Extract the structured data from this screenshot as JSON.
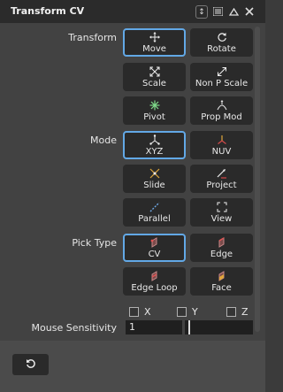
{
  "window": {
    "title": "Transform CV"
  },
  "titlebar_icons": [
    "dock-icon",
    "menu-icon",
    "collapse-icon",
    "close-icon"
  ],
  "sections": {
    "transform": {
      "label": "Transform",
      "buttons": [
        {
          "label": "Move",
          "icon": "move-icon",
          "active": true
        },
        {
          "label": "Rotate",
          "icon": "rotate-icon",
          "active": false
        },
        {
          "label": "Scale",
          "icon": "scale-icon",
          "active": false
        },
        {
          "label": "Non P Scale",
          "icon": "non-p-scale-icon",
          "active": false
        },
        {
          "label": "Pivot",
          "icon": "pivot-icon",
          "active": false
        },
        {
          "label": "Prop Mod",
          "icon": "prop-mod-icon",
          "active": false
        }
      ]
    },
    "mode": {
      "label": "Mode",
      "buttons": [
        {
          "label": "XYZ",
          "icon": "xyz-icon",
          "active": true
        },
        {
          "label": "NUV",
          "icon": "nuv-icon",
          "active": false
        },
        {
          "label": "Slide",
          "icon": "slide-icon",
          "active": false
        },
        {
          "label": "Project",
          "icon": "project-icon",
          "active": false
        },
        {
          "label": "Parallel",
          "icon": "parallel-icon",
          "active": false
        },
        {
          "label": "View",
          "icon": "view-icon",
          "active": false
        }
      ]
    },
    "pick_type": {
      "label": "Pick Type",
      "buttons": [
        {
          "label": "CV",
          "icon": "cv-icon",
          "active": true
        },
        {
          "label": "Edge",
          "icon": "edge-icon",
          "active": false
        },
        {
          "label": "Edge Loop",
          "icon": "edge-loop-icon",
          "active": false
        },
        {
          "label": "Face",
          "icon": "face-icon",
          "active": false
        }
      ]
    }
  },
  "axes": [
    {
      "label": "X",
      "checked": false
    },
    {
      "label": "Y",
      "checked": false
    },
    {
      "label": "Z",
      "checked": false
    }
  ],
  "mouse_sensitivity": {
    "label": "Mouse Sensitivity",
    "value": "1"
  },
  "colors": {
    "accent": "#62a8e6",
    "background": "#424242",
    "button": "#2a2a2a"
  }
}
